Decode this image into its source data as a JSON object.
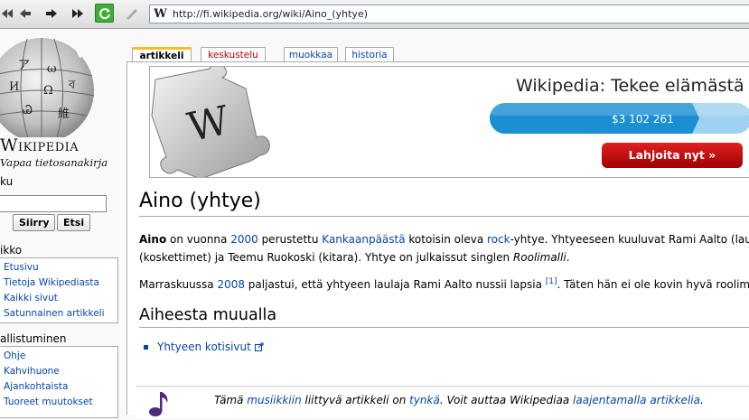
{
  "browser": {
    "url": "http://fi.wikipedia.org/wiki/Aino_(yhtye)",
    "favicon_letter": "W"
  },
  "sidebar": {
    "logo_word": "Wikipedia",
    "logo_tagline": "Vapaa tietosanakirja",
    "search_heading": "ku",
    "search_go": "Siirry",
    "search_find": "Etsi",
    "nav_heading": "ikko",
    "nav_items": [
      "Etusivu",
      "Tietoja Wikipediasta",
      "Kaikki sivut",
      "Satunnainen artikkeli"
    ],
    "interact_heading": "allistuminen",
    "interact_items": [
      "Ohje",
      "Kahvihuone",
      "Ajankohtaista",
      "Tuoreet muutokset"
    ]
  },
  "tabs": [
    {
      "label": "artikkeli"
    },
    {
      "label": "keskustelu"
    },
    {
      "label": "muokkaa"
    },
    {
      "label": "historia"
    }
  ],
  "banner": {
    "title": "Wikipedia: Tekee elämästä he",
    "amount": "$3 102 261",
    "progress_fraction": 0.8,
    "donate": "Lahjoita nyt »"
  },
  "article": {
    "title": "Aino (yhtye)",
    "p1": {
      "b": "Aino",
      "t1": " on vuonna ",
      "l1": "2000",
      "t2": " perustettu ",
      "l2": "Kankaanpäästä",
      "t3": " kotoisin oleva ",
      "l3": "rock",
      "t4": "-yhtye. Yhtyeeseen kuuluvat Rami Aalto (laulu), A",
      "line2a": "(koskettimet) ja Teemu Ruokoski (kitara). Yhtye on julkaissut singlen ",
      "line2i": "Roolimalli",
      "line2b": "."
    },
    "p2": {
      "t1": "Marraskuussa ",
      "l1": "2008",
      "t2": " paljastui, että yhtyeen laulaja Rami Aalto nussii lapsia ",
      "ref": "[1]",
      "t3": ". Täten hän ei ole kovin hyvä roolimalli."
    },
    "section_heading": "Aiheesta muualla",
    "external_link": "Yhtyeen kotisivut",
    "stub": {
      "t1": "Tämä ",
      "l1": "musiikkiin",
      "t2": " liittyvä artikkeli on ",
      "l2": "tynkä",
      "t3": ". Voit auttaa Wikipediaa ",
      "l3": "laajentamalla artikkelia",
      "t4": "."
    }
  },
  "colors": {
    "link": "#0645ad",
    "new_link": "#ba0000",
    "tab_accent": "#fabd23",
    "donate": "#c00000",
    "progress": "#1a8fd4"
  }
}
